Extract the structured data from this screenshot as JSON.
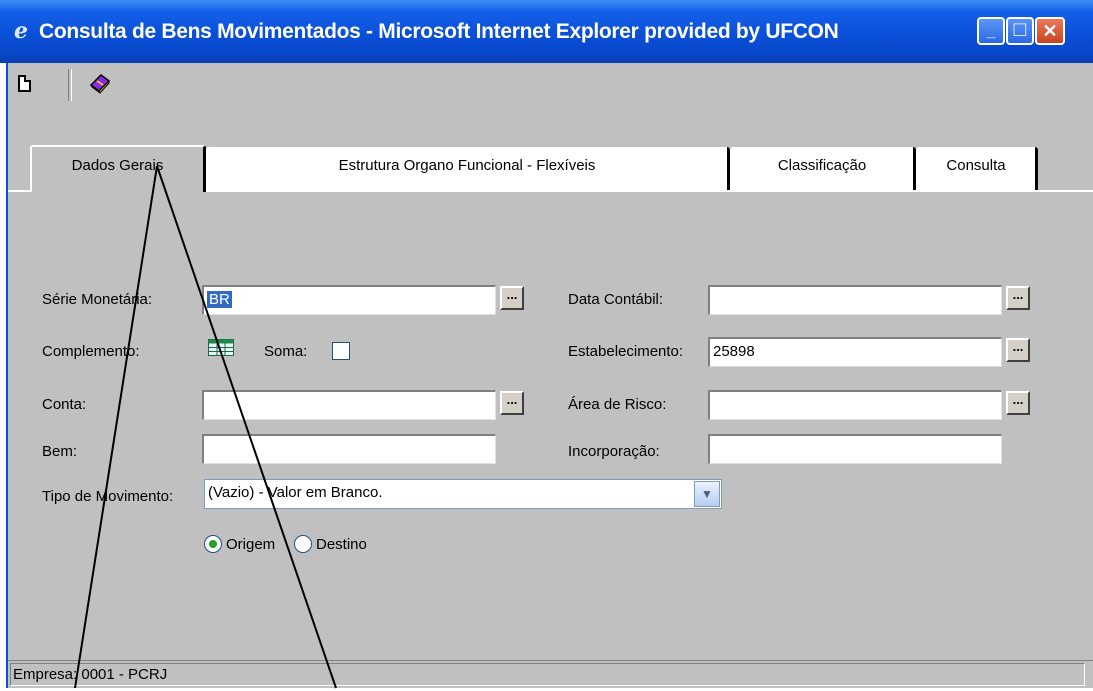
{
  "window": {
    "title": "Consulta de Bens Movimentados - Microsoft Internet Explorer provided by UFCON",
    "minimize_symbol": "_",
    "maximize_symbol": "□",
    "close_symbol": "✕"
  },
  "toolbar": {
    "new_icon": "document-icon",
    "help_icon": "book-icon"
  },
  "tabs": [
    {
      "label": "Dados Gerais",
      "active": true
    },
    {
      "label": "Estrutura Organo Funcional - Flexíveis",
      "active": false
    },
    {
      "label": "Classificação",
      "active": false
    },
    {
      "label": "Consulta",
      "active": false
    }
  ],
  "form": {
    "serie_monetaria": {
      "label": "Série Monetária:",
      "value": "BR"
    },
    "complemento": {
      "label": "Complemento:"
    },
    "soma": {
      "label": "Soma:",
      "checked": false
    },
    "conta": {
      "label": "Conta:",
      "value": ""
    },
    "bem": {
      "label": "Bem:",
      "value": ""
    },
    "tipo_movimento": {
      "label": "Tipo de Movimento:",
      "value": "(Vazio) - Valor em Branco."
    },
    "data_contabil": {
      "label": "Data Contábil:",
      "value": ""
    },
    "estabelecimento": {
      "label": "Estabelecimento:",
      "value": "25898"
    },
    "area_risco": {
      "label": "Área de Risco:",
      "value": ""
    },
    "incorporacao": {
      "label": "Incorporação:",
      "value": ""
    },
    "origem": {
      "label": "Origem",
      "selected": true
    },
    "destino": {
      "label": "Destino",
      "selected": false
    },
    "lookup_button_label": "..."
  },
  "status": {
    "text": "Empresa: 0001 - PCRJ"
  }
}
